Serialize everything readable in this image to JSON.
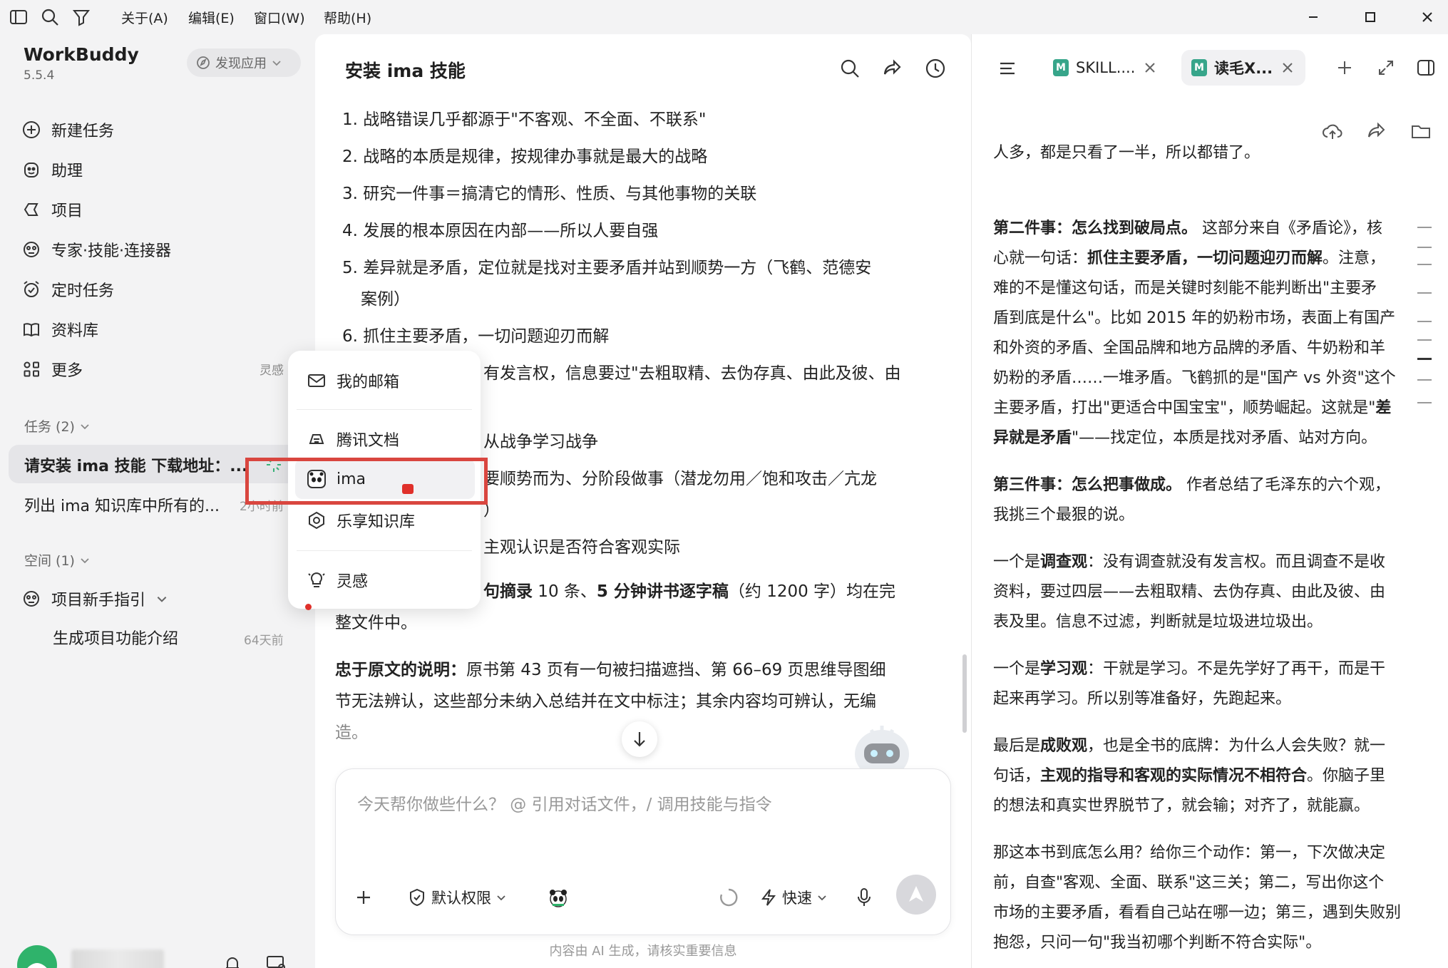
{
  "menubar": {
    "items": [
      "关于(A)",
      "编辑(E)",
      "窗口(W)",
      "帮助(H)"
    ]
  },
  "sidebar": {
    "brand": "WorkBuddy",
    "version": "5.5.4",
    "discover_label": "发现应用",
    "nav": [
      {
        "label": "新建任务",
        "icon": "plus-circle-icon"
      },
      {
        "label": "助理",
        "icon": "assistant-icon"
      },
      {
        "label": "项目",
        "icon": "project-icon"
      },
      {
        "label": "专家·技能·连接器",
        "icon": "expert-icon"
      },
      {
        "label": "定时任务",
        "icon": "alarm-clock-icon"
      },
      {
        "label": "资料库",
        "icon": "book-icon"
      },
      {
        "label": "更多",
        "icon": "grid-icon"
      }
    ],
    "more_hint": "灵感",
    "tasks_section": "任务 (2)",
    "tasks": [
      {
        "title": "请安装 ima 技能 下载地址：...",
        "time": ""
      },
      {
        "title": "列出 ima 知识库中所有的...",
        "time": "2小时前"
      }
    ],
    "space_section": "空间 (1)",
    "space_item": "项目新手指引",
    "space_sub": "生成项目功能介绍",
    "space_sub_time": "64天前"
  },
  "popup": {
    "items": [
      {
        "label": "我的邮箱",
        "icon": "mail-icon"
      },
      {
        "label": "腾讯文档",
        "icon": "tencent-docs-icon"
      },
      {
        "label": "ima",
        "icon": "panda-icon"
      },
      {
        "label": "乐享知识库",
        "icon": "lexiang-icon"
      },
      {
        "label": "灵感",
        "icon": "bulb-icon"
      }
    ]
  },
  "chat": {
    "title": "安装 ima 技能",
    "lines": [
      "1. 战略错误几乎都源于\"不客观、不全面、不联系\"",
      "2. 战略的本质是规律，按规律办事就是最大的战略",
      "3. 研究一件事＝搞清它的情形、性质、与其他事物的关联",
      "4. 发展的根本原因在内部——所以人要自强",
      "5. 差异就是矛盾，定位就是找对主要矛盾并站到顺势一方（飞鹤、范德安",
      "案例）",
      "6. 抓住主要矛盾，一切问题迎刃而解",
      "有发言权，信息要过\"去粗取精、去伪存真、由此及彼、由",
      "从战争学习战争",
      "要顺势而为、分阶段做事（潜龙勿用／饱和攻击／亢龙",
      "）",
      "主观认识是否符合客观实际"
    ],
    "summary_bold_a": "句摘录",
    "summary_text_a": " 10 条、",
    "summary_bold_b": "5 分钟讲书逐字稿",
    "summary_text_b": "（约 1200 字）均在完",
    "summary_line2": "整文件中。",
    "note_bold": "忠于原文的说明：",
    "note_text": "原书第 43 页有一句被扫描遮挡、第 66–69 页思维导图细",
    "note_line2": "节无法辨认，这些部分未纳入总结并在文中标注；其余内容均可辨认，无编",
    "note_line3": "造。",
    "input_placeholder": "今天帮你做些什么？ @ 引用对话文件，/ 调用技能与指令",
    "permission_label": "默认权限",
    "speed_label": "快速",
    "footnote": "内容由 AI 生成，请核实重要信息"
  },
  "doc": {
    "tabs": [
      {
        "label": "SKILL....",
        "badge": "M"
      },
      {
        "label": "读毛X...",
        "badge": "M"
      }
    ],
    "lines": [
      {
        "segments": [
          {
            "t": "人多，都是只看了一半，所以都错了。",
            "b": false
          }
        ]
      },
      {
        "segments": [
          {
            "t": "第二件事：怎么找到破局点。",
            "b": true
          },
          {
            "t": " 这部分来自《矛盾论》，核",
            "b": false
          }
        ]
      },
      {
        "segments": [
          {
            "t": "心就一句话：",
            "b": false
          },
          {
            "t": "抓住主要矛盾，一切问题迎刃而解",
            "b": true
          },
          {
            "t": "。注意，",
            "b": false
          }
        ]
      },
      {
        "segments": [
          {
            "t": "难的不是懂这句话，而是关键时刻能不能判断出\"主要矛",
            "b": false
          }
        ]
      },
      {
        "segments": [
          {
            "t": "盾到底是什么\"。比如 2015 年的奶粉市场，表面上有国产",
            "b": false
          }
        ]
      },
      {
        "segments": [
          {
            "t": "和外资的矛盾、全国品牌和地方品牌的矛盾、牛奶粉和羊",
            "b": false
          }
        ]
      },
      {
        "segments": [
          {
            "t": "奶粉的矛盾……一堆矛盾。飞鹤抓的是\"国产 vs 外资\"这个",
            "b": false
          }
        ]
      },
      {
        "segments": [
          {
            "t": "主要矛盾，打出\"更适合中国宝宝\"，顺势崛起。这就是\"",
            "b": false
          },
          {
            "t": "差",
            "b": true
          }
        ]
      },
      {
        "segments": [
          {
            "t": "异就是矛盾",
            "b": true
          },
          {
            "t": "\"——找定位，本质是找对矛盾、站对方向。",
            "b": false
          }
        ]
      },
      {
        "segments": [
          {
            "t": "第三件事：怎么把事做成。",
            "b": true
          },
          {
            "t": " 作者总结了毛泽东的六个观，",
            "b": false
          }
        ]
      },
      {
        "segments": [
          {
            "t": "我挑三个最狠的说。",
            "b": false
          }
        ]
      },
      {
        "segments": [
          {
            "t": "一个是",
            "b": false
          },
          {
            "t": "调查观",
            "b": true
          },
          {
            "t": "：没有调查就没有发言权。而且调查不是收",
            "b": false
          }
        ]
      },
      {
        "segments": [
          {
            "t": "资料，要过四层——去粗取精、去伪存真、由此及彼、由",
            "b": false
          }
        ]
      },
      {
        "segments": [
          {
            "t": "表及里。信息不过滤，判断就是垃圾进垃圾出。",
            "b": false
          }
        ]
      },
      {
        "segments": [
          {
            "t": "一个是",
            "b": false
          },
          {
            "t": "学习观",
            "b": true
          },
          {
            "t": "：干就是学习。不是先学好了再干，而是干",
            "b": false
          }
        ]
      },
      {
        "segments": [
          {
            "t": "起来再学习。所以别等准备好，先跑起来。",
            "b": false
          }
        ]
      },
      {
        "segments": [
          {
            "t": "最后是",
            "b": false
          },
          {
            "t": "成败观",
            "b": true
          },
          {
            "t": "，也是全书的底牌：为什么人会失败？就一",
            "b": false
          }
        ]
      },
      {
        "segments": [
          {
            "t": "句话，",
            "b": false
          },
          {
            "t": "主观的指导和客观的实际情况不相符合",
            "b": true
          },
          {
            "t": "。你脑子里",
            "b": false
          }
        ]
      },
      {
        "segments": [
          {
            "t": "的想法和真实世界脱节了，就会输；对齐了，就能赢。",
            "b": false
          }
        ]
      },
      {
        "segments": [
          {
            "t": "那这本书到底怎么用？给你三个动作：第一，下次做决定",
            "b": false
          }
        ]
      },
      {
        "segments": [
          {
            "t": "前，自查\"客观、全面、联系\"这三关；第二，写出你这个",
            "b": false
          }
        ]
      },
      {
        "segments": [
          {
            "t": "市场的主要矛盾，看看自己站在哪一边；第三，遇到失败别",
            "b": false
          }
        ]
      },
      {
        "segments": [
          {
            "t": "抱怨，只问一句\"我当初哪个判断不符合实际\"。",
            "b": false
          }
        ]
      }
    ]
  },
  "colors": {
    "accent_red": "#d9463f",
    "md_badge": "#37a58a",
    "avatar": "#2fb36b"
  }
}
